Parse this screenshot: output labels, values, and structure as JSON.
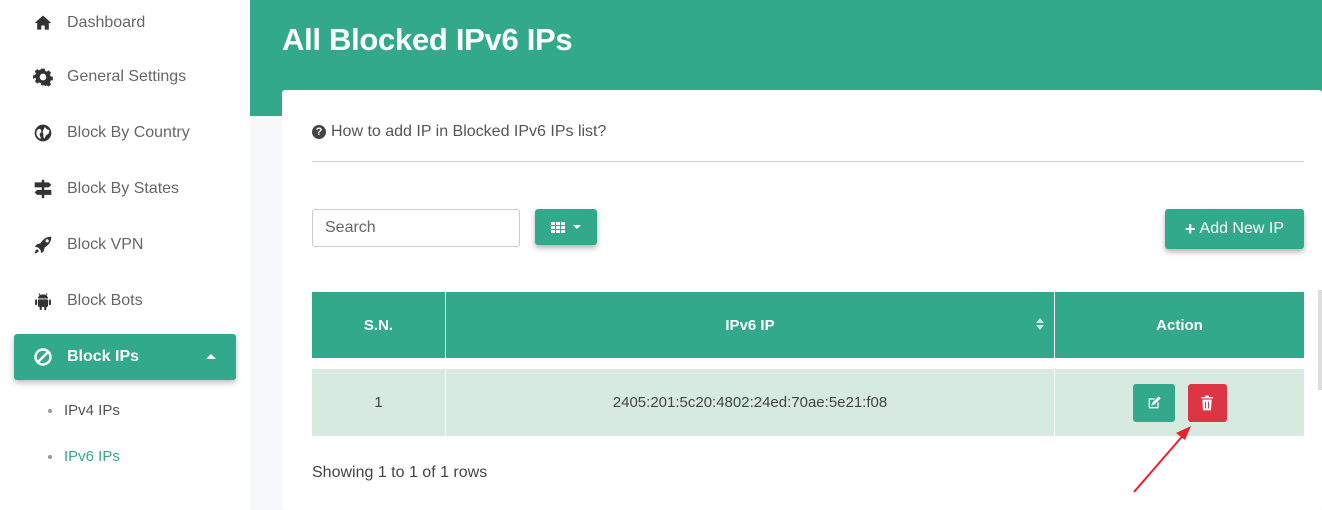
{
  "sidebar": {
    "items": [
      {
        "label": "Dashboard",
        "icon": "home-icon"
      },
      {
        "label": "General Settings",
        "icon": "gear-icon"
      },
      {
        "label": "Block By Country",
        "icon": "globe-icon"
      },
      {
        "label": "Block By States",
        "icon": "signpost-icon"
      },
      {
        "label": "Block VPN",
        "icon": "rocket-icon"
      },
      {
        "label": "Block Bots",
        "icon": "android-icon"
      },
      {
        "label": "Block IPs",
        "icon": "ban-icon",
        "active": true
      }
    ],
    "subitems": [
      {
        "label": "IPv4 IPs"
      },
      {
        "label": "IPv6 IPs",
        "active": true
      }
    ]
  },
  "header": {
    "title": "All Blocked IPv6 IPs"
  },
  "help": {
    "text": "How to add IP in Blocked IPv6 IPs list?"
  },
  "toolbar": {
    "search_placeholder": "Search",
    "columns_icon": "grid-icon",
    "add_label": "Add New IP"
  },
  "table": {
    "headers": [
      "S.N.",
      "IPv6 IP",
      "Action"
    ],
    "rows": [
      {
        "sn": "1",
        "ip": "2405:201:5c20:4802:24ed:70ae:5e21:f08"
      }
    ]
  },
  "footer": {
    "showing": "Showing 1 to 1 of 1 rows"
  },
  "colors": {
    "accent": "#31a98a",
    "danger": "#de3545",
    "row_bg": "#d6eadf",
    "annotation": "#e8202a"
  }
}
